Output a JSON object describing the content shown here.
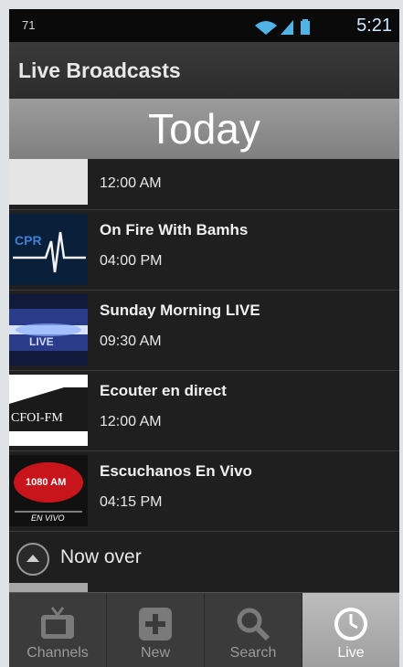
{
  "status_bar": {
    "notification": "71",
    "time": "5:21"
  },
  "action_bar": {
    "title": "Live Broadcasts"
  },
  "day_header": "Today",
  "broadcasts": [
    {
      "name": "",
      "time": "12:00 AM",
      "thumb": "blank"
    },
    {
      "name": "On Fire With Bamhs",
      "time": "04:00 PM",
      "thumb": "cpr"
    },
    {
      "name": "Sunday Morning LIVE",
      "time": "09:30 AM",
      "thumb": "live"
    },
    {
      "name": "Ecouter en direct",
      "time": "12:00 AM",
      "thumb": "cfoi",
      "thumb_text": "CFOI-FM"
    },
    {
      "name": "Escuchanos En Vivo",
      "time": "04:15 PM",
      "thumb": "radio",
      "thumb_text_top": "1080 AM",
      "thumb_text_bottom": "EN VIVO"
    }
  ],
  "now_over": {
    "label": "Now over"
  },
  "tabs": [
    {
      "label": "Channels",
      "icon": "tv-icon",
      "active": false
    },
    {
      "label": "New",
      "icon": "plus-icon",
      "active": false
    },
    {
      "label": "Search",
      "icon": "search-icon",
      "active": false
    },
    {
      "label": "Live",
      "icon": "clock-icon",
      "active": true
    }
  ],
  "colors": {
    "background": "#1f1f1f",
    "action_bar": "#333333",
    "day_header": "#8e8e8e",
    "active_tab": "#b0b0b0",
    "status_icons": "#4fb3e6"
  }
}
